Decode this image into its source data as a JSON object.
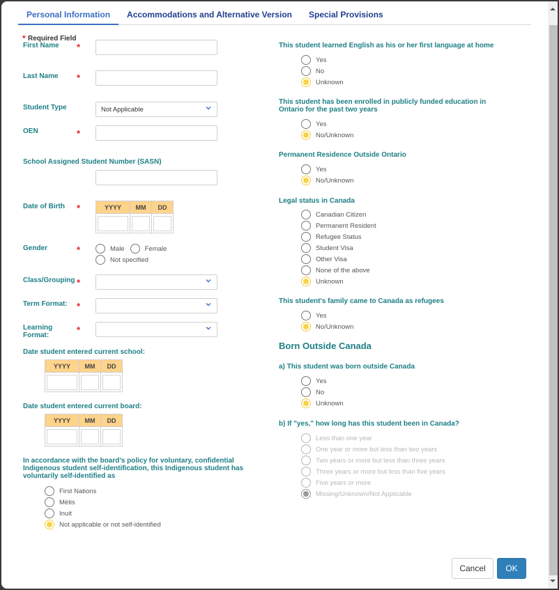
{
  "tabs": [
    {
      "label": "Personal Information",
      "active": true
    },
    {
      "label": "Accommodations and Alternative Version",
      "active": false
    },
    {
      "label": "Special Provisions",
      "active": false
    }
  ],
  "required_note": "Required Field",
  "required_marker": "*",
  "left": {
    "first_name": {
      "label": "First Name",
      "value": ""
    },
    "last_name": {
      "label": "Last Name",
      "value": ""
    },
    "student_type": {
      "label": "Student Type",
      "selected": "Not Applicable"
    },
    "oen": {
      "label": "OEN",
      "value": ""
    },
    "sasn": {
      "label": "School Assigned Student Number (SASN)",
      "value": ""
    },
    "dob": {
      "label": "Date of Birth",
      "cols": [
        "YYYY",
        "MM",
        "DD"
      ]
    },
    "gender": {
      "label": "Gender",
      "options": [
        "Male",
        "Female",
        "Not specified"
      ],
      "selected": null
    },
    "class_grouping": {
      "label": "Class/Grouping",
      "selected": ""
    },
    "term_format": {
      "label": "Term Format:",
      "selected": ""
    },
    "learning_format": {
      "label": "Learning Format:",
      "label_line1": "Learning",
      "label_line2": "Format:",
      "selected": ""
    },
    "date_school": {
      "label": "Date student entered current school:",
      "cols": [
        "YYYY",
        "MM",
        "DD"
      ]
    },
    "date_board": {
      "label": "Date student entered current board:",
      "cols": [
        "YYYY",
        "MM",
        "DD"
      ]
    },
    "indigenous": {
      "label_line1": "In accordance with the board’s policy for voluntary, confidential",
      "label_line2": "Indigenous student self-identification, this Indigenous student has",
      "label_line3": "voluntarily self-identified as",
      "options": [
        "First Nations",
        "Métis",
        "Inuit",
        "Not applicable or not self-identified"
      ],
      "selected": "Not applicable or not self-identified"
    }
  },
  "right": {
    "english_first": {
      "label": "This student learned English as his or her first language at home",
      "options": [
        "Yes",
        "No",
        "Unknown"
      ],
      "selected": "Unknown"
    },
    "enrolled_ontario": {
      "label_line1": "This student has been enrolled in publicly funded education in",
      "label_line2": "Ontario for the past two years",
      "options": [
        "Yes",
        "No/Unknown"
      ],
      "selected": "No/Unknown"
    },
    "permanent_residence": {
      "label": "Permanent Residence Outside Ontario",
      "options": [
        "Yes",
        "No/Unknown"
      ],
      "selected": "No/Unknown"
    },
    "legal_status": {
      "label": "Legal status in Canada",
      "options": [
        "Canadian Citizen",
        "Permanent Resident",
        "Refugee Status",
        "Student Visa",
        "Other Visa",
        "None of the above",
        "Unknown"
      ],
      "selected": "Unknown"
    },
    "family_refugees": {
      "label": "This student's family came to Canada as refugees",
      "options": [
        "Yes",
        "No/Unknown"
      ],
      "selected": "No/Unknown"
    },
    "born_outside_heading": "Born Outside Canada",
    "born_outside": {
      "label": "a) This student was born outside Canada",
      "options": [
        "Yes",
        "No",
        "Unknown"
      ],
      "selected": "Unknown"
    },
    "years_in_canada": {
      "label": "b) If \"yes,\" how long has this student been in Canada?",
      "options": [
        "Less than one year",
        "One year or more but less than two years",
        "Two years or more but less than three years",
        "Three years or more but less than five years",
        "Five years or more",
        "Missing/Unknown/Not Applicable"
      ],
      "selected": "Missing/Unknown/Not Applicable",
      "disabled": true
    }
  },
  "buttons": {
    "cancel": "Cancel",
    "ok": "OK"
  },
  "colors": {
    "accent": "#3b6fc4",
    "label": "#1e7f86",
    "required": "#e0242b",
    "radio_selected": "#f7d34a",
    "date_header": "#fed38a",
    "ok_button": "#2f7fb8"
  }
}
